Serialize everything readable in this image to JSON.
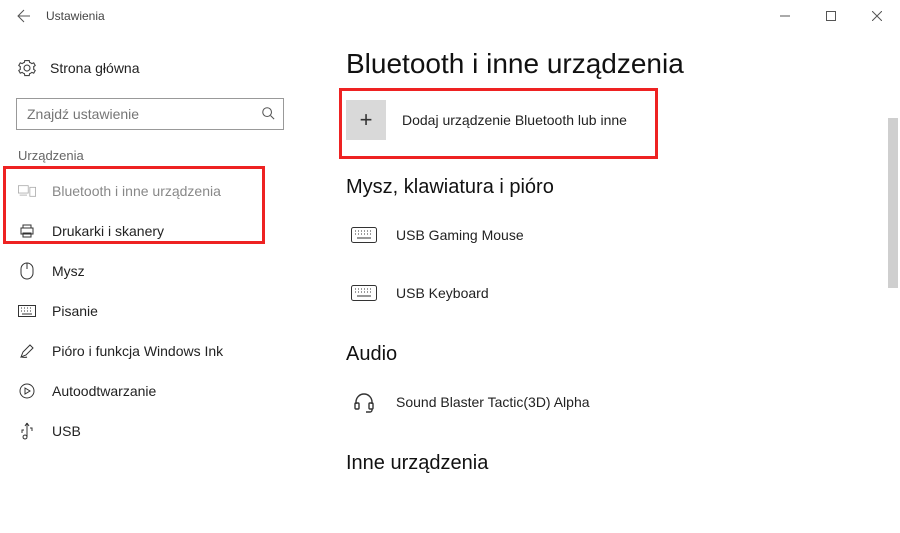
{
  "window": {
    "title": "Ustawienia"
  },
  "sidebar": {
    "home": "Strona główna",
    "search_placeholder": "Znajdź ustawienie",
    "category": "Urządzenia",
    "items": [
      {
        "label": "Bluetooth i inne urządzenia"
      },
      {
        "label": "Drukarki i skanery"
      },
      {
        "label": "Mysz"
      },
      {
        "label": "Pisanie"
      },
      {
        "label": "Pióro i funkcja Windows Ink"
      },
      {
        "label": "Autoodtwarzanie"
      },
      {
        "label": "USB"
      }
    ]
  },
  "main": {
    "title": "Bluetooth i inne urządzenia",
    "add_label": "Dodaj urządzenie Bluetooth lub inne",
    "sections": {
      "input_header": "Mysz, klawiatura i pióro",
      "input_devices": [
        {
          "name": "USB Gaming Mouse"
        },
        {
          "name": "USB Keyboard"
        }
      ],
      "audio_header": "Audio",
      "audio_devices": [
        {
          "name": "Sound Blaster Tactic(3D) Alpha"
        }
      ],
      "other_header": "Inne urządzenia"
    }
  }
}
